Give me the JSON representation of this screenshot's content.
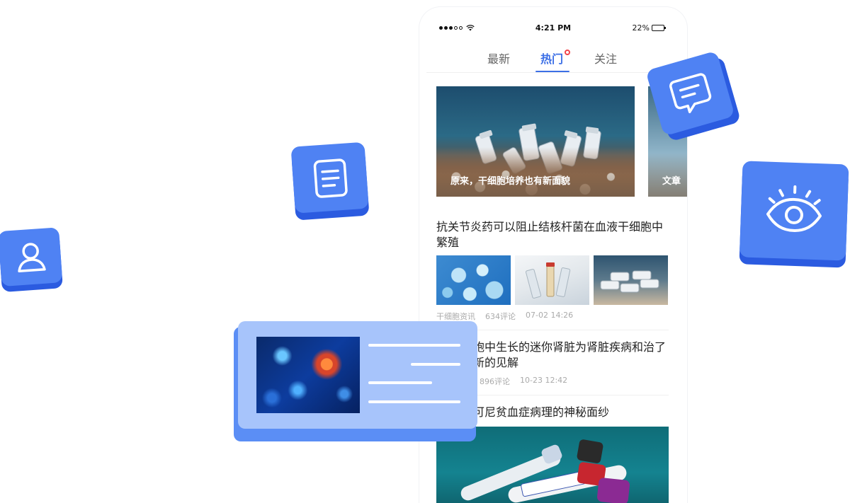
{
  "status_bar": {
    "time": "4:21 PM",
    "battery": "22%"
  },
  "tabs": [
    {
      "label": "最新"
    },
    {
      "label": "热门"
    },
    {
      "label": "关注"
    }
  ],
  "active_tab": "热门",
  "banners": [
    {
      "caption": "原来，干细胞培养也有新面貌"
    },
    {
      "caption": "文章"
    }
  ],
  "articles": [
    {
      "title": "抗关节炎药可以阻止结核杆菌在血液干细胞中繁殖",
      "source": "干细胞资讯",
      "comments": "634评论",
      "date": "07-02 14:26"
    },
    {
      "title": "胞中生长的迷你肾脏为肾脏疾病和治了新的见解",
      "comments": "896评论",
      "date": "10-23 12:42"
    },
    {
      "title": "可尼贫血症病理的神秘面纱"
    }
  ],
  "colors": {
    "accent": "#3c6fe6",
    "tile": "#4f82f3",
    "badge": "#f2454b"
  },
  "icons": [
    "user-icon",
    "document-icon",
    "chat-icon",
    "eye-icon",
    "wifi-icon",
    "battery-icon"
  ]
}
